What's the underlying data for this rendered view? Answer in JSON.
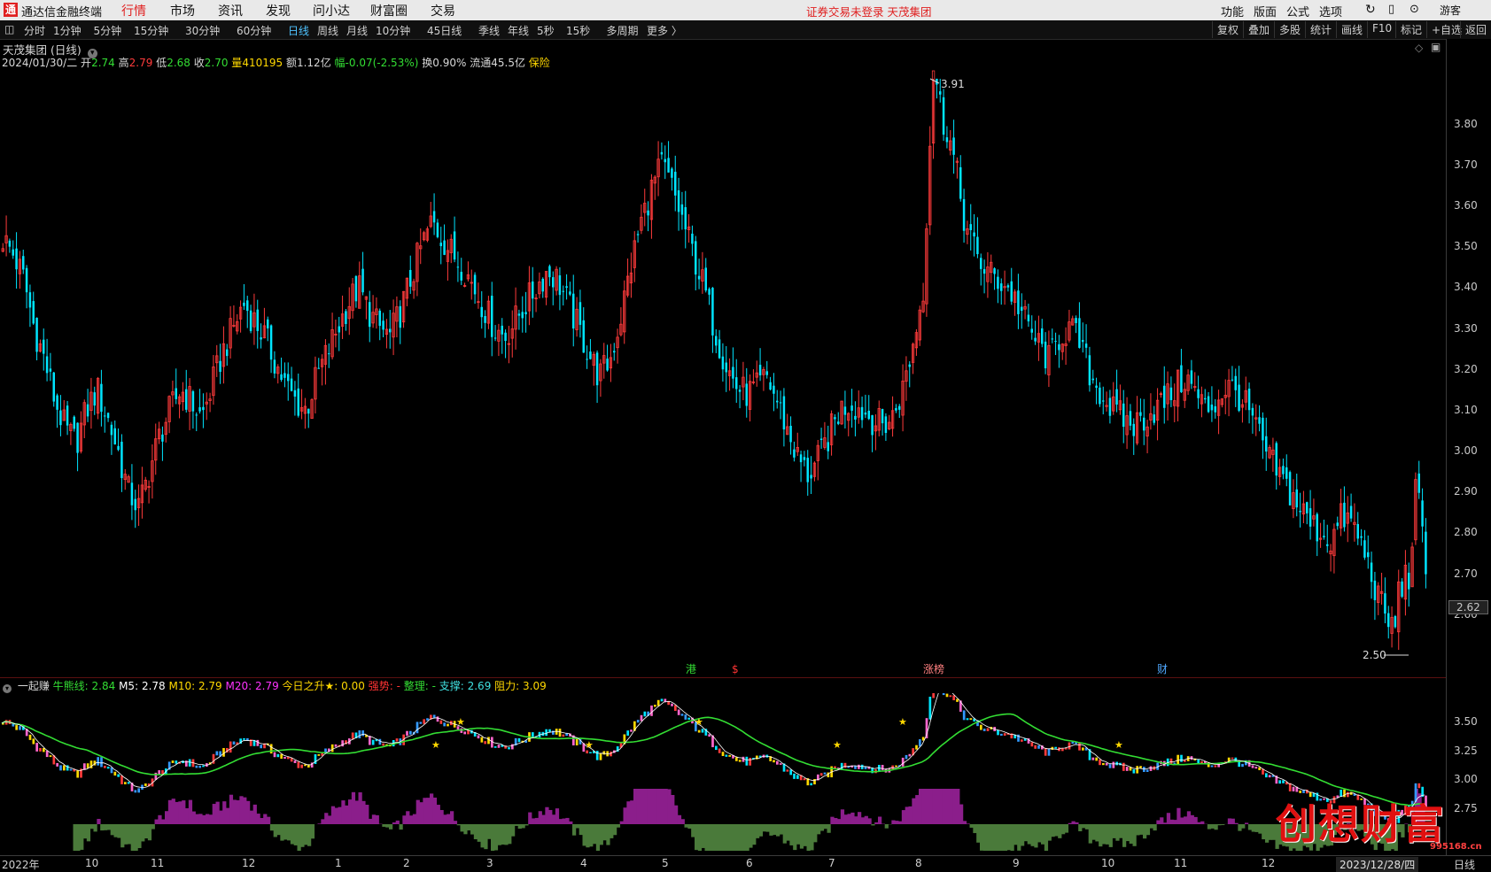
{
  "menubar": {
    "logo": "通",
    "app_name": "通达信金融终端",
    "menus": [
      "行情",
      "市场",
      "资讯",
      "发现",
      "问小达",
      "财富圈",
      "交易"
    ],
    "active_menu": "行情",
    "warning": "证券交易未登录  天茂集团",
    "right_items": [
      "功能",
      "版面",
      "公式",
      "选项"
    ],
    "user": "游客"
  },
  "toolbar": {
    "periods": [
      "分时",
      "1分钟",
      "5分钟",
      "15分钟",
      "30分钟",
      "60分钟",
      "日线",
      "周线",
      "月线",
      "10分钟",
      "45日线",
      "季线",
      "年线",
      "5秒",
      "15秒",
      "多周期",
      "更多 〉"
    ],
    "active_period": "日线",
    "right_buttons": [
      "复权",
      "叠加",
      "多股",
      "统计",
      "画线",
      "F10",
      "标记",
      "+自选",
      "返回"
    ]
  },
  "header": {
    "title": "天茂集团 (日线)",
    "date": "2024/01/30/二",
    "open_label": "开",
    "open": "2.74",
    "high_label": "高",
    "high": "2.79",
    "low_label": "低",
    "low": "2.68",
    "close_label": "收",
    "close": "2.70",
    "volume_label": "量",
    "volume": "410195",
    "amount_label": "额",
    "amount": "1.12亿",
    "change_label": "幅",
    "change": "-0.07(-2.53%)",
    "turnover_label": "换",
    "turnover": "0.90%",
    "float_label": "流通",
    "float": "45.5亿",
    "sector": "保险"
  },
  "indicator": {
    "name": "一起赚",
    "items": [
      {
        "label": "牛熊线:",
        "value": "2.84",
        "color": "#33dd33"
      },
      {
        "label": "M5:",
        "value": "2.78",
        "color": "#ffffff"
      },
      {
        "label": "M10:",
        "value": "2.79",
        "color": "#ffd800"
      },
      {
        "label": "M20:",
        "value": "2.79",
        "color": "#ff33ff"
      },
      {
        "label": "今日之升★:",
        "value": "0.00",
        "color": "#ffd800"
      },
      {
        "label": "强势:",
        "value": "-",
        "color": "#ff3333"
      },
      {
        "label": "整理:",
        "value": "-",
        "color": "#33dd33"
      },
      {
        "label": "支撑:",
        "value": "2.69",
        "color": "#40e0e0"
      },
      {
        "label": "阻力:",
        "value": "3.09",
        "color": "#ffd800"
      }
    ]
  },
  "event_markers": [
    {
      "text": "港",
      "color": "#33dd33"
    },
    {
      "text": "$",
      "color": "#ff3333"
    },
    {
      "text": "涨榜",
      "color": "#ff8080"
    },
    {
      "text": "财",
      "color": "#4fa8ff"
    }
  ],
  "annotations": {
    "high": "3.91",
    "low": "2.50",
    "current": "2.62"
  },
  "watermark": {
    "text": "创想财富",
    "url": "995168.cn"
  },
  "colors": {
    "up": "#ff3b3b",
    "down": "#00e5ff",
    "bull_line": "#33dd33",
    "accent": "#e02020"
  },
  "chart_data": {
    "type": "candlestick",
    "y_ticks": [
      "3.80",
      "3.70",
      "3.60",
      "3.50",
      "3.40",
      "3.30",
      "3.20",
      "3.10",
      "3.00",
      "2.90",
      "2.80",
      "2.70",
      "2.60"
    ],
    "ylim": [
      2.5,
      3.91
    ],
    "indicator_ticks": [
      "3.50",
      "3.25",
      "3.00",
      "2.75"
    ],
    "x_labels": [
      "2022年",
      "10",
      "11",
      "12",
      "1",
      "2",
      "3",
      "4",
      "5",
      "6",
      "7",
      "8",
      "9",
      "10",
      "11",
      "12",
      "2023/12/28/四",
      "日线"
    ],
    "series_close": [
      3.52,
      3.48,
      3.42,
      3.3,
      3.22,
      3.12,
      3.05,
      3.02,
      3.1,
      3.15,
      3.08,
      3.0,
      2.9,
      2.86,
      2.95,
      3.04,
      3.1,
      3.15,
      3.12,
      3.08,
      3.16,
      3.24,
      3.3,
      3.36,
      3.32,
      3.28,
      3.22,
      3.16,
      3.12,
      3.1,
      3.18,
      3.24,
      3.3,
      3.36,
      3.4,
      3.34,
      3.3,
      3.28,
      3.34,
      3.42,
      3.5,
      3.56,
      3.52,
      3.48,
      3.45,
      3.4,
      3.35,
      3.3,
      3.28,
      3.32,
      3.36,
      3.4,
      3.44,
      3.42,
      3.36,
      3.3,
      3.24,
      3.18,
      3.22,
      3.32,
      3.45,
      3.56,
      3.64,
      3.7,
      3.64,
      3.56,
      3.48,
      3.4,
      3.3,
      3.22,
      3.16,
      3.14,
      3.15,
      3.18,
      3.12,
      3.05,
      2.98,
      2.94,
      2.98,
      3.04,
      3.1,
      3.12,
      3.1,
      3.08,
      3.06,
      3.08,
      3.15,
      3.26,
      3.4,
      3.6,
      3.82,
      3.7,
      3.55,
      3.48,
      3.44,
      3.42,
      3.4,
      3.36,
      3.3,
      3.26,
      3.22,
      3.28,
      3.3,
      3.26,
      3.18,
      3.14,
      3.1,
      3.08,
      3.06,
      3.08,
      3.1,
      3.12,
      3.15,
      3.18,
      3.14,
      3.1,
      3.12,
      3.16,
      3.14,
      3.1,
      3.04,
      2.98,
      2.94,
      2.9,
      2.86,
      2.82,
      2.8,
      2.78,
      2.84,
      2.82,
      2.76,
      2.68,
      2.6,
      2.56,
      2.8,
      2.96,
      2.7
    ]
  }
}
